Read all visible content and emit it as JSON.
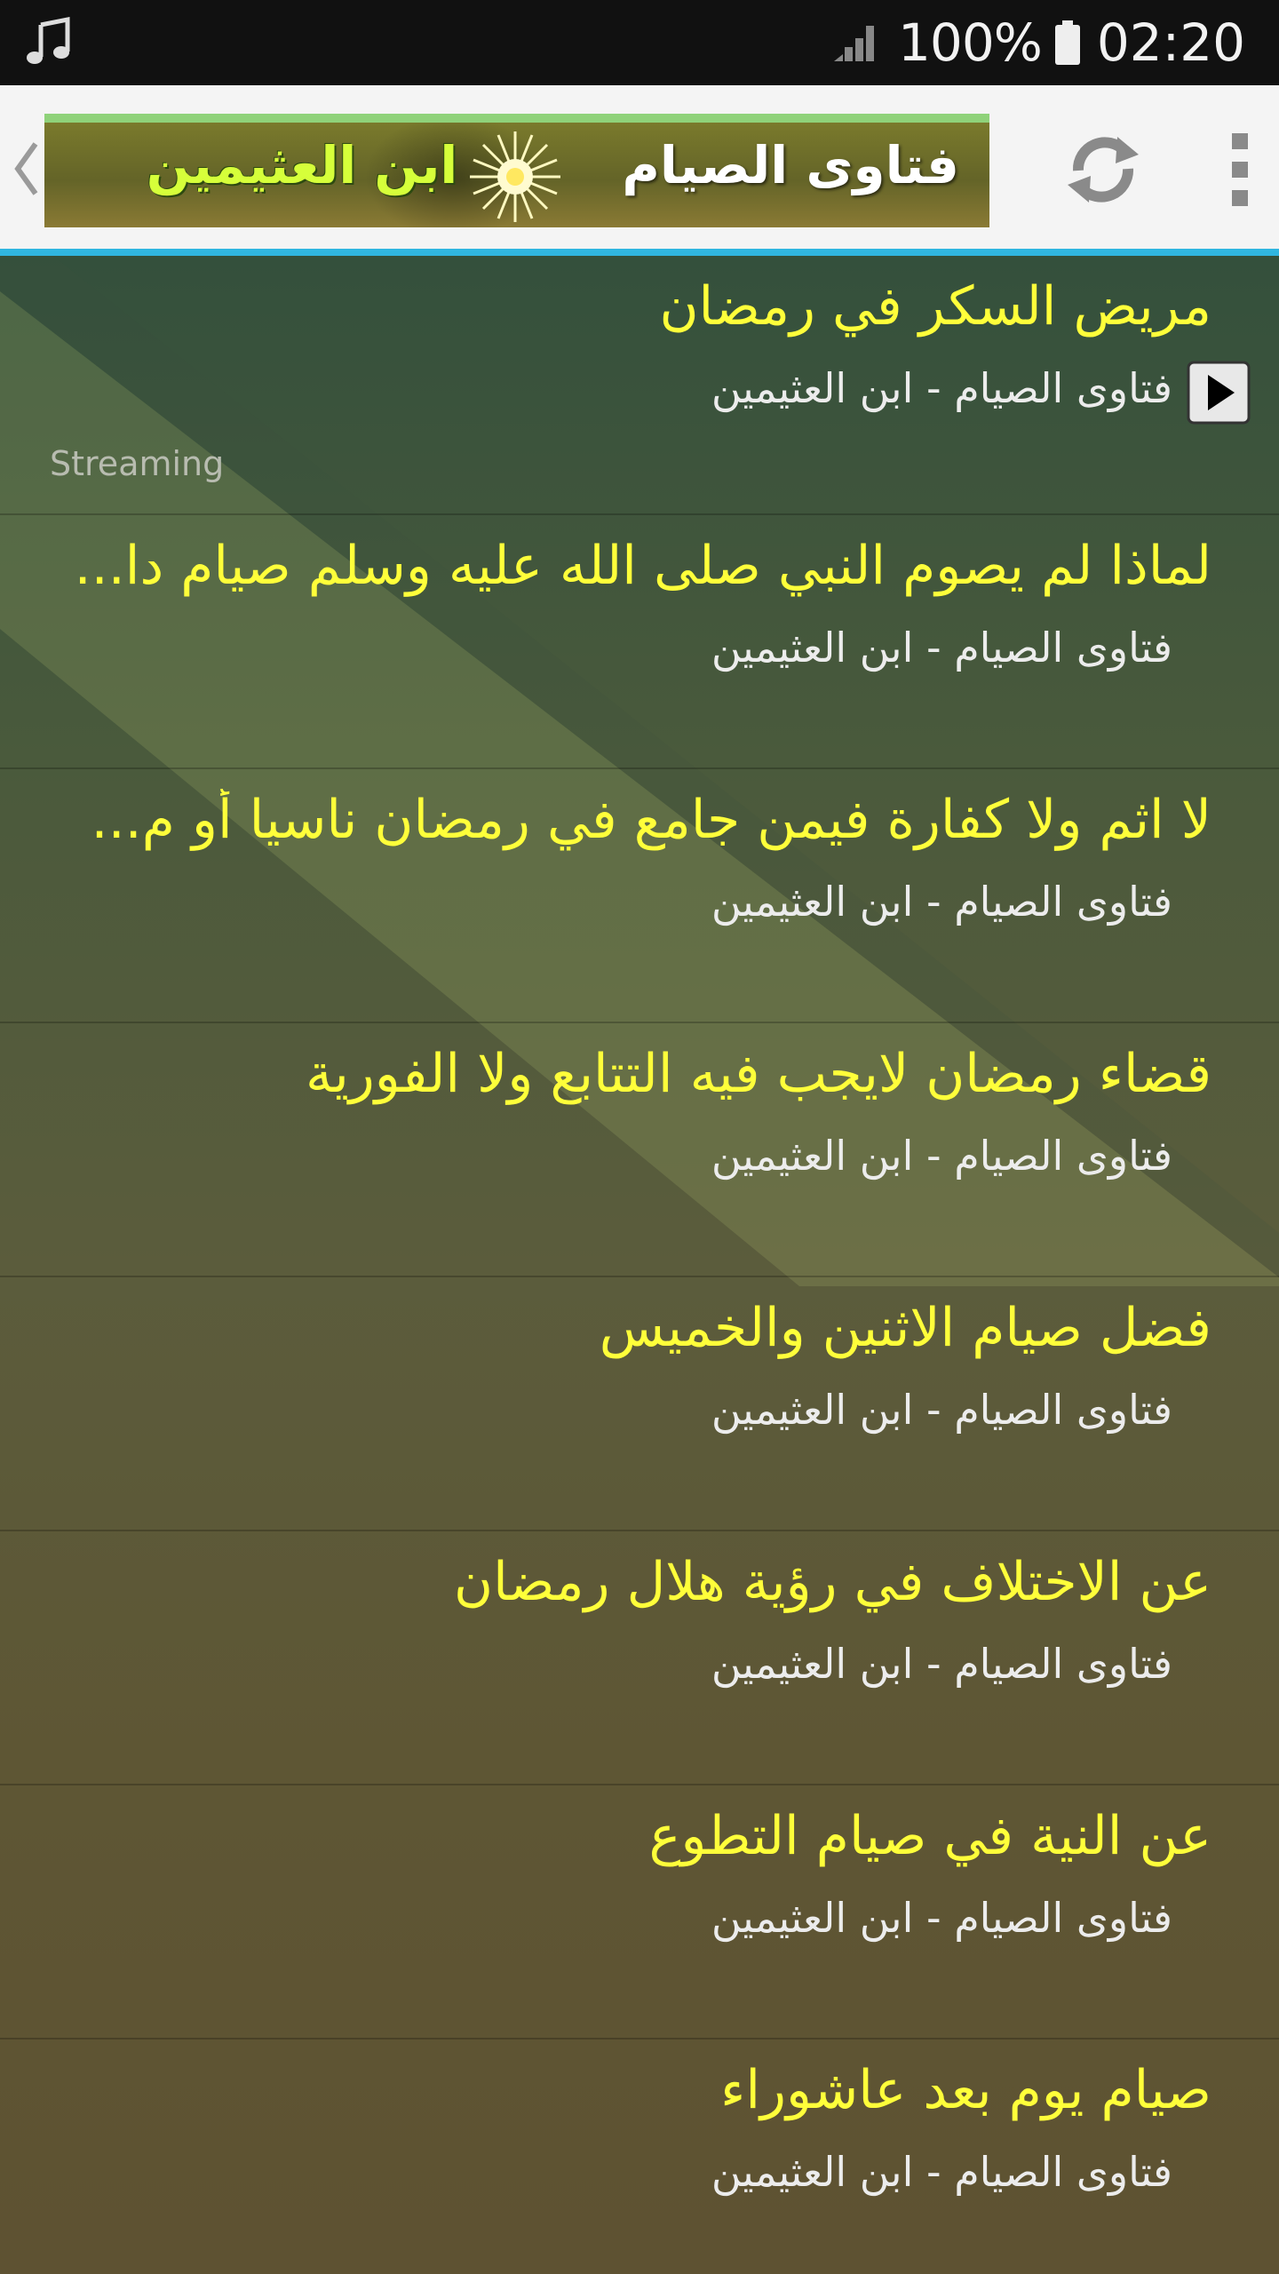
{
  "status_bar": {
    "battery": "100%",
    "time": "02:20",
    "icons": [
      "music-note-icon",
      "signal-icon",
      "battery-icon"
    ]
  },
  "action_bar": {
    "banner_title": "فتاوى الصيام",
    "banner_author": "ابن العثيمين",
    "icons": [
      "back-chevron-icon",
      "star-icon",
      "refresh-icon",
      "overflow-menu-icon"
    ],
    "accent_color": "#30b6e0"
  },
  "list": {
    "streaming_label": "Streaming",
    "title_color": "#ffff3a",
    "items": [
      {
        "title": "مريض السكر في رمضان",
        "subtitle": "فتاوى الصيام - ابن العثيمين"
      },
      {
        "title": "لماذا لم يصوم النبي صلى الله عليه وسلم صيام دا...",
        "subtitle": "فتاوى الصيام - ابن العثيمين"
      },
      {
        "title": "لا اثم ولا كفارة فيمن جامع في رمضان ناسيا أو م...",
        "subtitle": "فتاوى الصيام - ابن العثيمين"
      },
      {
        "title": "قضاء رمضان لايجب فيه التتابع ولا الفورية",
        "subtitle": "فتاوى الصيام - ابن العثيمين"
      },
      {
        "title": "فضل صيام الاثنين والخميس",
        "subtitle": "فتاوى الصيام - ابن العثيمين"
      },
      {
        "title": "عن الاختلاف في رؤية هلال رمضان",
        "subtitle": "فتاوى الصيام - ابن العثيمين"
      },
      {
        "title": "عن النية في صيام التطوع",
        "subtitle": "فتاوى الصيام - ابن العثيمين"
      },
      {
        "title": "صيام يوم بعد عاشوراء",
        "subtitle": "فتاوى الصيام - ابن العثيمين"
      }
    ]
  }
}
